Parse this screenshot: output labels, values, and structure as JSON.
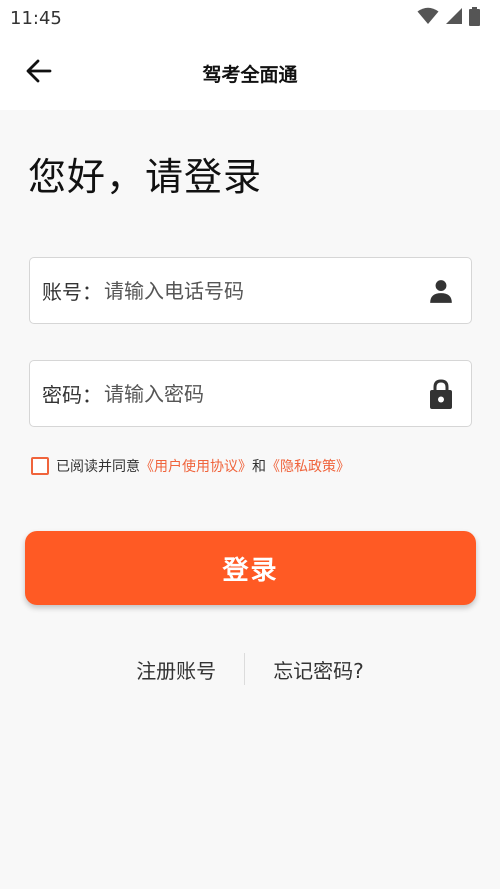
{
  "status_bar": {
    "time": "11:45",
    "icons": [
      "wifi-icon",
      "signal-icon",
      "battery-icon"
    ]
  },
  "app_bar": {
    "title": "驾考全面通",
    "back_icon": "arrow-left-icon"
  },
  "greeting": "您好，请登录",
  "account_field": {
    "label": "账号：",
    "placeholder": "请输入电话号码",
    "icon": "person-icon"
  },
  "password_field": {
    "label": "密码：",
    "placeholder": "请输入密码",
    "icon": "lock-icon"
  },
  "agreement": {
    "checked": false,
    "prefix": "已阅读并同意",
    "user_agreement": "《用户使用协议》",
    "conjunction": "和",
    "privacy_policy": "《隐私政策》"
  },
  "login_button": {
    "label": "登录"
  },
  "links": {
    "register": "注册账号",
    "forgot_password": "忘记密码?"
  },
  "colors": {
    "accent": "#ff5a24",
    "link": "#f0643c",
    "background": "#f8f8f8"
  }
}
